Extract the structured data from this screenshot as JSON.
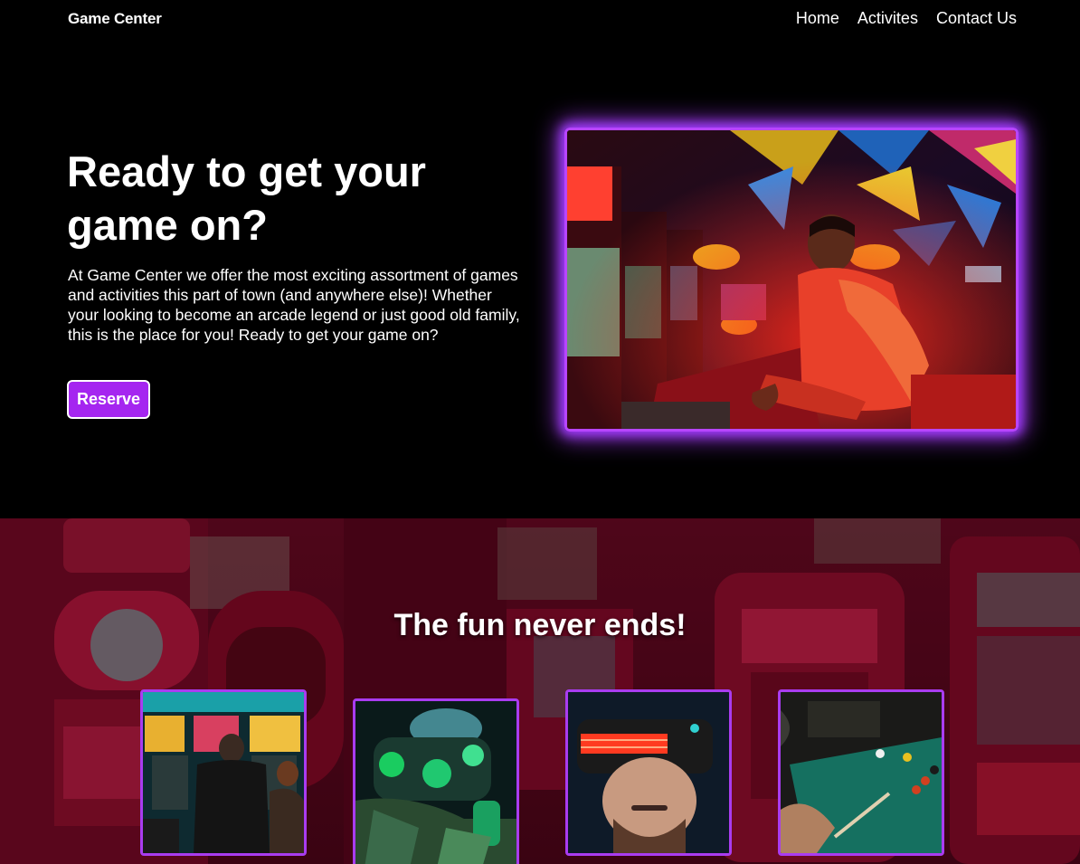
{
  "nav": {
    "brand": "Game Center",
    "links": [
      "Home",
      "Activites",
      "Contact Us"
    ]
  },
  "hero": {
    "title": "Ready to get your game on?",
    "text": "At Game Center we offer the most exciting assortment of games and activities this part of town (and anywhere else)! Whether your looking to become an arcade legend or just good old family, this is the place for you! Ready to get your game on?",
    "button_label": "Reserve",
    "image_alt": "Person playing arcade racing game"
  },
  "fun": {
    "title": "The fun never ends!",
    "cards": [
      {
        "name": "pinball-arcade-photo"
      },
      {
        "name": "laser-tag-photo"
      },
      {
        "name": "vr-headset-photo"
      },
      {
        "name": "billiards-photo"
      }
    ]
  },
  "colors": {
    "accent": "#a526f0",
    "glow": "#b845ff",
    "background": "#000000"
  }
}
